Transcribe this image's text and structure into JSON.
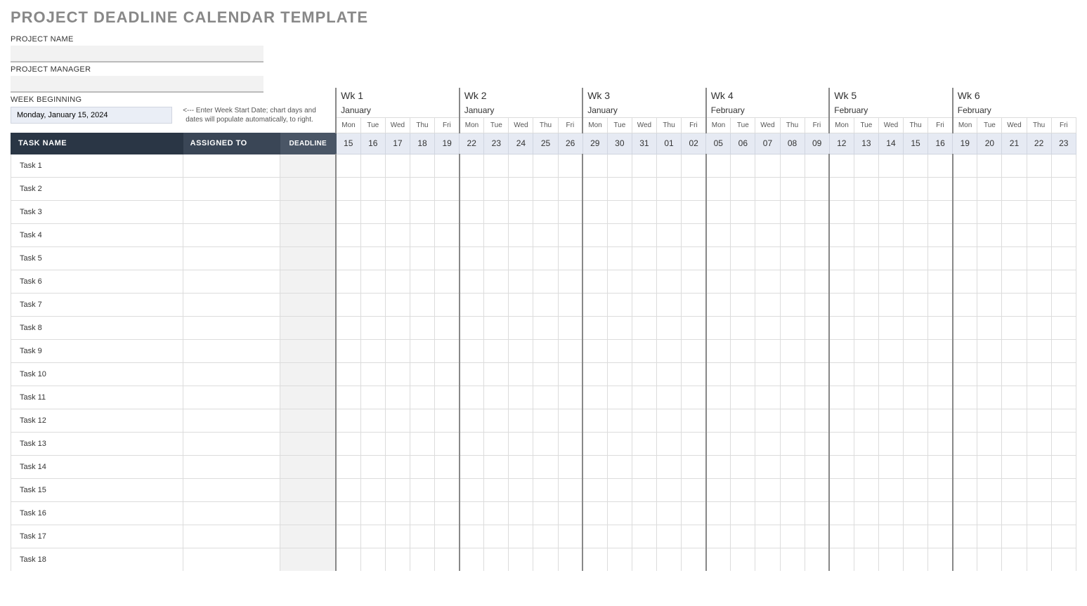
{
  "title": "PROJECT DEADLINE CALENDAR TEMPLATE",
  "labels": {
    "project_name": "PROJECT NAME",
    "project_manager": "PROJECT MANAGER",
    "week_beginning": "WEEK BEGINNING",
    "hint": "<--- Enter Week Start Date; chart days and dates will populate automatically, to right."
  },
  "inputs": {
    "project_name_value": "",
    "project_manager_value": "",
    "week_beginning_value": "Monday, January 15, 2024"
  },
  "columns": {
    "task_name": "TASK NAME",
    "assigned_to": "ASSIGNED TO",
    "deadline": "DEADLINE"
  },
  "weeks": [
    {
      "label": "Wk 1",
      "month": "January",
      "dows": [
        "Mon",
        "Tue",
        "Wed",
        "Thu",
        "Fri"
      ],
      "dates": [
        "15",
        "16",
        "17",
        "18",
        "19"
      ]
    },
    {
      "label": "Wk 2",
      "month": "January",
      "dows": [
        "Mon",
        "Tue",
        "Wed",
        "Thu",
        "Fri"
      ],
      "dates": [
        "22",
        "23",
        "24",
        "25",
        "26"
      ]
    },
    {
      "label": "Wk 3",
      "month": "January",
      "dows": [
        "Mon",
        "Tue",
        "Wed",
        "Thu",
        "Fri"
      ],
      "dates": [
        "29",
        "30",
        "31",
        "01",
        "02"
      ]
    },
    {
      "label": "Wk 4",
      "month": "February",
      "dows": [
        "Mon",
        "Tue",
        "Wed",
        "Thu",
        "Fri"
      ],
      "dates": [
        "05",
        "06",
        "07",
        "08",
        "09"
      ]
    },
    {
      "label": "Wk 5",
      "month": "February",
      "dows": [
        "Mon",
        "Tue",
        "Wed",
        "Thu",
        "Fri"
      ],
      "dates": [
        "12",
        "13",
        "14",
        "15",
        "16"
      ]
    },
    {
      "label": "Wk 6",
      "month": "February",
      "dows": [
        "Mon",
        "Tue",
        "Wed",
        "Thu",
        "Fri"
      ],
      "dates": [
        "19",
        "20",
        "21",
        "22",
        "23"
      ]
    }
  ],
  "tasks": [
    "Task 1",
    "Task 2",
    "Task 3",
    "Task 4",
    "Task 5",
    "Task 6",
    "Task 7",
    "Task 8",
    "Task 9",
    "Task 10",
    "Task 11",
    "Task 12",
    "Task 13",
    "Task 14",
    "Task 15",
    "Task 16",
    "Task 17",
    "Task 18"
  ]
}
